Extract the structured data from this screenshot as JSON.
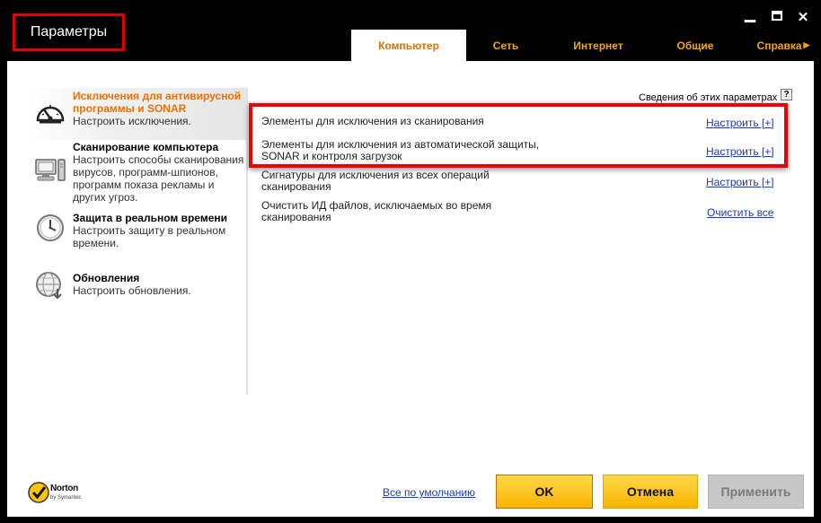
{
  "window": {
    "title": "Параметры",
    "controls": [
      "minimize-icon",
      "maximize-icon",
      "close-icon"
    ]
  },
  "tabs": [
    {
      "label": "Компьютер",
      "active": true
    },
    {
      "label": "Сеть"
    },
    {
      "label": "Интернет"
    },
    {
      "label": "Общие"
    },
    {
      "label": "Справка"
    }
  ],
  "sidebar": {
    "items": [
      {
        "title": "Исключения для антивирусной программы и SONAR",
        "desc": "Настроить исключения.",
        "icon": "gauge-icon",
        "active": true
      },
      {
        "title": "Сканирование компьютера",
        "desc": "Настроить способы сканирования вирусов, программ-шпионов, программ показа рекламы и других угроз.",
        "icon": "computer-icon"
      },
      {
        "title": "Защита в реальном времени",
        "desc": "Настроить защиту в реальном времени.",
        "icon": "clock-icon"
      },
      {
        "title": "Обновления",
        "desc": "Настроить обновления.",
        "icon": "globe-update-icon"
      }
    ]
  },
  "content": {
    "info_link": "Сведения об этих параметрах",
    "info_icon": "?",
    "rows": [
      {
        "label": "Элементы для исключения из сканирования",
        "action": "Настроить [+]"
      },
      {
        "label": "Элементы для исключения из автоматической защиты, SONAR и контроля загрузок",
        "action": "Настроить [+]"
      },
      {
        "label": "Сигнатуры для исключения из всех операций сканирования",
        "action": "Настроить [+]"
      },
      {
        "label": "Очистить ИД файлов, исключаемых во время сканирования",
        "action": "Очистить все"
      }
    ]
  },
  "footer": {
    "logo_name": "Norton",
    "logo_sub": "by Symantec",
    "defaults_link": "Все по умолчанию",
    "ok": "OK",
    "cancel": "Отмена",
    "apply": "Применить"
  },
  "colors": {
    "accent_orange": "#ee7000",
    "tab_text": "#f2a700",
    "link_blue": "#1a3cba",
    "highlight_red": "#f00000",
    "button_yellow": "#f7b500"
  }
}
